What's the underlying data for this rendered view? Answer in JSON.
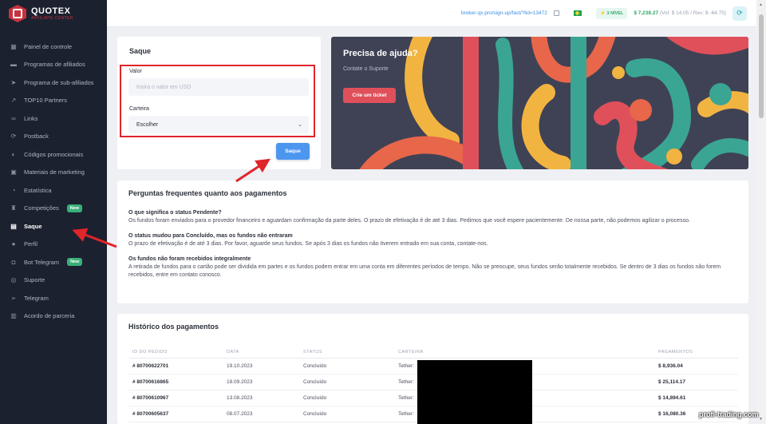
{
  "logo": {
    "name": "QUOTEX",
    "sub": "AFFILIATE CENTER"
  },
  "sidebar": {
    "items": [
      {
        "label": "Painel de controle",
        "icon": "dashboard-icon"
      },
      {
        "label": "Programas de afiliados",
        "icon": "folder-icon"
      },
      {
        "label": "Programa de sub-afiliados",
        "icon": "send-icon"
      },
      {
        "label": "TOP10 Partners",
        "icon": "trend-icon"
      },
      {
        "label": "Links",
        "icon": "link-icon"
      },
      {
        "label": "Postback",
        "icon": "refresh-icon"
      },
      {
        "label": "Códigos promocionais",
        "icon": "toggle-icon"
      },
      {
        "label": "Materiais de marketing",
        "icon": "image-icon"
      },
      {
        "label": "Estatística",
        "icon": "pie-chart-icon"
      },
      {
        "label": "Competições",
        "icon": "trophy-icon",
        "badge": "New"
      },
      {
        "label": "Saque",
        "icon": "wallet-icon",
        "active": true
      },
      {
        "label": "Perfil",
        "icon": "user-icon"
      },
      {
        "label": "Bot Telegram",
        "icon": "bot-icon",
        "badge": "New"
      },
      {
        "label": "Suporte",
        "icon": "headset-icon"
      },
      {
        "label": "Telegram",
        "icon": "telegram-icon"
      },
      {
        "label": "Acordo de parceria",
        "icon": "document-icon"
      }
    ]
  },
  "topbar": {
    "ref_link": "broker-qx.pro/sign-up/fast/?lid=13472",
    "level": "3 NÍVEL",
    "balance": "$ 7,238.27",
    "balance_sub": "(Vol: $ 14.05 / Rev: $ -64.75)"
  },
  "saque": {
    "title": "Saque",
    "valor_label": "Valor",
    "valor_placeholder": "Insira o valor em USD",
    "carteira_label": "Carteira",
    "carteira_value": "Escolher",
    "button": "Saque"
  },
  "help": {
    "title": "Precisa de ajuda?",
    "subtitle": "Contate o Suporte",
    "button": "Crie um ticket"
  },
  "faq": {
    "title": "Perguntas frequentes quanto aos pagamentos",
    "items": [
      {
        "q": "O que significa o status Pendente?",
        "a": "Os fundos foram enviados para o provedor financeiro e aguardam confirmação da parte deles. O prazo de efetivação é de até 3 dias. Pedimos que você espere pacientemente. De nossa parte, não podemos agilizar o processo."
      },
      {
        "q": "O status mudou para Concluído, mas os fundos não entraram",
        "a": "O prazo de efetivação é de até 3 dias. Por favor, aguarde seus fundos. Se após 3 dias os fundos não tiverem entrado em sua conta, contate-nos."
      },
      {
        "q": "Os fundos não foram recebidos integralmente",
        "a": "A retirada de fundos para o cartão pode ser dividida em partes e os fundos podem entrar em uma conta em diferentes períodos de tempo. Não se preocupe, seus fundos serão totalmente recebidos. Se dentro de 3 dias os fundos não forem recebidos, entre em contato conosco."
      }
    ]
  },
  "history": {
    "title": "Histórico dos pagamentos",
    "columns": [
      "ID DO PEDIDO",
      "DATA",
      "STATUS",
      "CARTEIRA",
      "PAGAMENTOS"
    ],
    "rows": [
      {
        "id": "# 80700622701",
        "date": "19.10.2023",
        "status": "Concluído",
        "wallet": "Tether:",
        "amount": "$ 8,936.04"
      },
      {
        "id": "# 80700616865",
        "date": "18.09.2023",
        "status": "Concluído",
        "wallet": "Tether:",
        "amount": "$ 25,114.17"
      },
      {
        "id": "# 80700610967",
        "date": "13.08.2023",
        "status": "Concluído",
        "wallet": "Tether:",
        "amount": "$ 14,894.61"
      },
      {
        "id": "# 80700605637",
        "date": "08.07.2023",
        "status": "Concluído",
        "wallet": "Tether:",
        "amount": "$ 16,080.36"
      }
    ]
  },
  "watermark": "profi-trading.com",
  "colors": {
    "sidebar": "#1c2130",
    "accent_red": "#e0252b",
    "button_blue": "#4d96f0",
    "green": "#2ea86a"
  }
}
